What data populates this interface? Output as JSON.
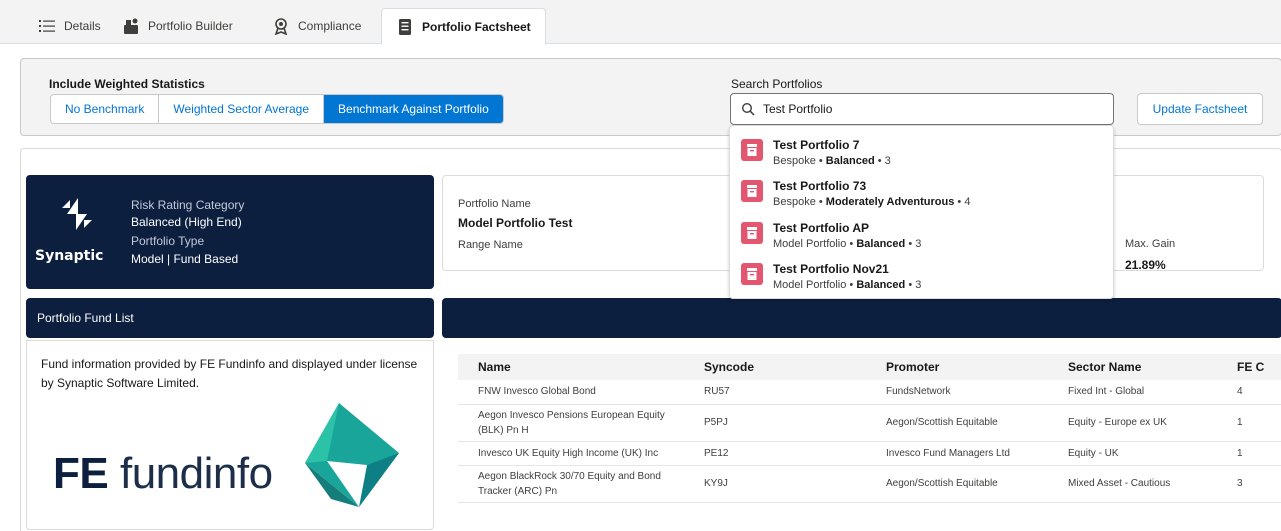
{
  "tabs": [
    {
      "label": "Details",
      "icon": "list-icon"
    },
    {
      "label": "Portfolio Builder",
      "icon": "builder-icon"
    },
    {
      "label": "Compliance",
      "icon": "compliance-icon"
    },
    {
      "label": "Portfolio Factsheet",
      "icon": "factsheet-icon",
      "active": true
    }
  ],
  "controls": {
    "weighted_label": "Include Weighted Statistics",
    "benchmark_options": [
      "No Benchmark",
      "Weighted Sector Average",
      "Benchmark Against Portfolio"
    ],
    "benchmark_selected": "Benchmark Against Portfolio",
    "search_label": "Search Portfolios",
    "search_value": "Test Portfolio",
    "update_button": "Update Factsheet"
  },
  "dropdown": [
    {
      "title": "Test Portfolio 7",
      "type": "Bespoke",
      "risk": "Balanced",
      "level": "3"
    },
    {
      "title": "Test Portfolio 73",
      "type": "Bespoke",
      "risk": "Moderately Adventurous",
      "level": "4"
    },
    {
      "title": "Test Portfolio AP",
      "type": "Model Portfolio",
      "risk": "Balanced",
      "level": "3"
    },
    {
      "title": "Test Portfolio Nov21",
      "type": "Model Portfolio",
      "risk": "Balanced",
      "level": "3"
    }
  ],
  "synaptic": {
    "logo_text": "Synaptic",
    "risk_label": "Risk Rating Category",
    "risk_value": "Balanced (High End)",
    "type_label": "Portfolio Type",
    "type_value": "Model | Fund Based"
  },
  "portfolio": {
    "name_label": "Portfolio Name",
    "name_value": "Model Portfolio Test",
    "range_label": "Range Name",
    "max_gain_label": "Max. Gain",
    "max_gain_value": "21.89%"
  },
  "fund_list": {
    "title": "Portfolio Fund List",
    "info": "Fund information provided by FE Fundinfo and displayed under license by Synaptic Software Limited.",
    "logo_fe": "FE",
    "logo_word": "fundinfo"
  },
  "table": {
    "headers": [
      "Name",
      "Syncode",
      "Promoter",
      "Sector Name",
      "FE C"
    ],
    "rows": [
      [
        "FNW Invesco Global Bond",
        "RU57",
        "FundsNetwork",
        "Fixed Int - Global",
        "4"
      ],
      [
        "Aegon Invesco Pensions European Equity (BLK) Pn H",
        "P5PJ",
        "Aegon/Scottish Equitable",
        "Equity - Europe ex UK",
        "1"
      ],
      [
        "Invesco UK Equity High Income (UK) Inc",
        "PE12",
        "Invesco Fund Managers Ltd",
        "Equity - UK",
        "1"
      ],
      [
        "Aegon BlackRock 30/70 Equity and Bond Tracker (ARC) Pn",
        "KY9J",
        "Aegon/Scottish Equitable",
        "Mixed Asset - Cautious",
        "3"
      ]
    ]
  },
  "colors": {
    "navy": "#0d1f3f",
    "blue": "#0176d3",
    "pink": "#e3566f",
    "fe_teal": "#1aa59a"
  }
}
